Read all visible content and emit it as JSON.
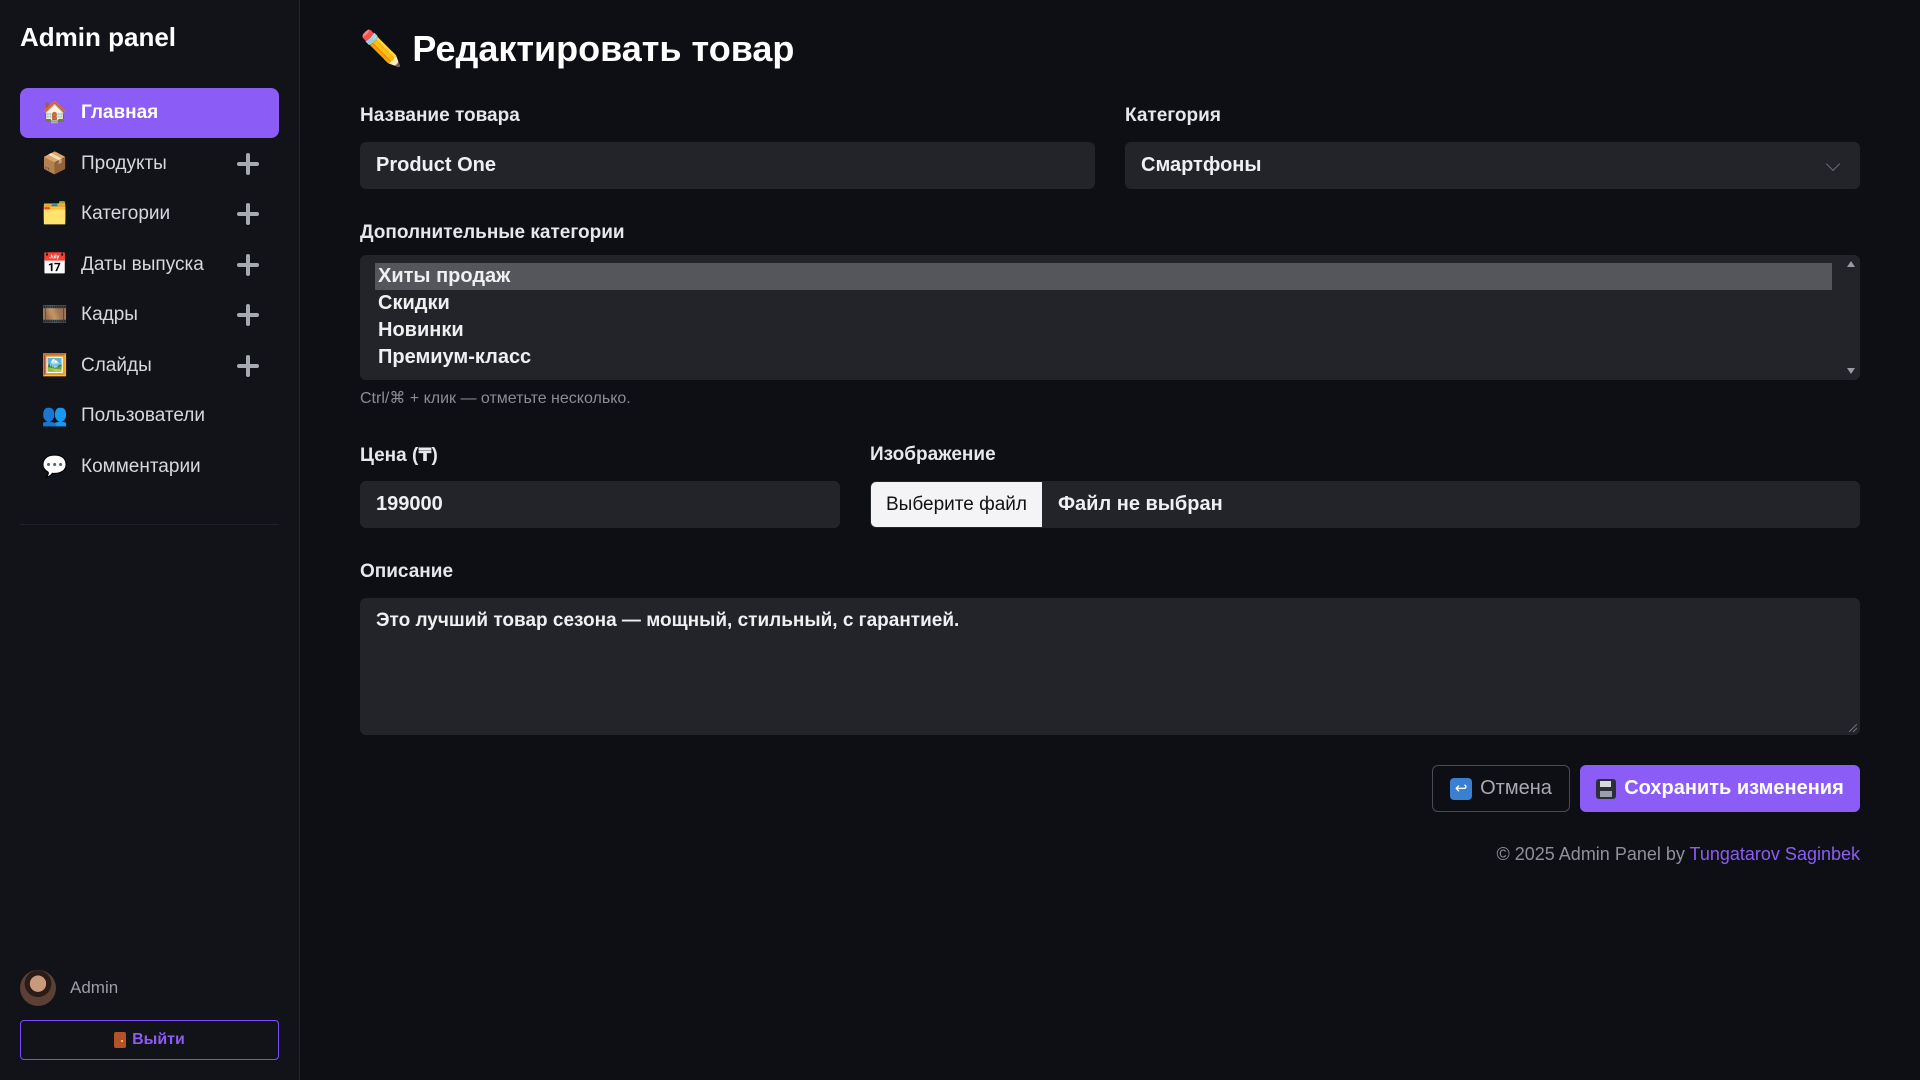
{
  "sidebar": {
    "brand": "Admin panel",
    "items": [
      {
        "label": "Главная",
        "icon": "🏠",
        "icon_name": "house-icon",
        "active": true,
        "has_add": false
      },
      {
        "label": "Продукты",
        "icon": "📦",
        "icon_name": "package-icon",
        "active": false,
        "has_add": true
      },
      {
        "label": "Категории",
        "icon": "🗂️",
        "icon_name": "folder-icon",
        "active": false,
        "has_add": true
      },
      {
        "label": "Даты выпуска",
        "icon": "📅",
        "icon_name": "calendar-icon",
        "active": false,
        "has_add": true
      },
      {
        "label": "Кадры",
        "icon": "🎞️",
        "icon_name": "film-frames-icon",
        "active": false,
        "has_add": true
      },
      {
        "label": "Слайды",
        "icon": "🖼️",
        "icon_name": "picture-icon",
        "active": false,
        "has_add": true
      },
      {
        "label": "Пользователи",
        "icon": "👥",
        "icon_name": "users-icon",
        "active": false,
        "has_add": false
      },
      {
        "label": "Комментарии",
        "icon": "💬",
        "icon_name": "speech-bubble-icon",
        "active": false,
        "has_add": false
      }
    ],
    "user": {
      "name": "Admin"
    },
    "logout_label": "Выйти"
  },
  "main": {
    "title": "Редактировать товар",
    "title_icon": "✏️",
    "product_name": {
      "label": "Название товара",
      "value": "Product One"
    },
    "category": {
      "label": "Категория",
      "value": "Смартфоны"
    },
    "extra_categories": {
      "label": "Дополнительные категории",
      "options": [
        "Хиты продаж",
        "Скидки",
        "Новинки",
        "Премиум-класс"
      ],
      "selected": "Хиты продаж",
      "hint": "Ctrl/⌘ + клик — отметьте несколько."
    },
    "price": {
      "label": "Цена (₸)",
      "value": "199000"
    },
    "image": {
      "label": "Изображение",
      "button": "Выберите файл",
      "status": "Файл не выбран"
    },
    "description": {
      "label": "Описание",
      "value": "Это лучший товар сезона — мощный, стильный, с гарантией."
    },
    "buttons": {
      "cancel": "Отмена",
      "save": "Сохранить изменения"
    },
    "footer": {
      "text": "© 2025 Admin Panel by ",
      "author": "Tungatarov Saginbek"
    }
  },
  "colors": {
    "accent": "#8b5cf6",
    "background": "#0e0f14",
    "sidebar": "#121319",
    "input": "#22242a"
  }
}
